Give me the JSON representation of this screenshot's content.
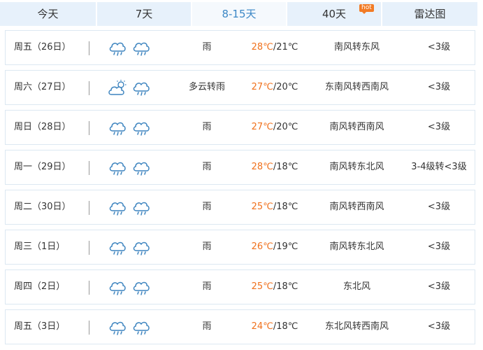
{
  "tabs": [
    {
      "label": "今天",
      "active": false
    },
    {
      "label": "7天",
      "active": false
    },
    {
      "label": "8-15天",
      "active": true
    },
    {
      "label": "40天",
      "active": false,
      "badge": "hot"
    },
    {
      "label": "雷达图",
      "active": false
    }
  ],
  "colors": {
    "accent": "#3c88c6",
    "tab_bg": "#e7f1fb",
    "high_temp": "#f0711c",
    "hot_badge": "#f27b25"
  },
  "forecast": [
    {
      "date": "周五（26日）",
      "icons": [
        "rain-cloud-icon",
        "rain-cloud-icon"
      ],
      "weather": "雨",
      "high": "28℃",
      "low": "/21℃",
      "wind": "南风转东风",
      "level": "<3级"
    },
    {
      "date": "周六（27日）",
      "icons": [
        "partly-cloudy-icon",
        "rain-cloud-icon"
      ],
      "weather": "多云转雨",
      "high": "27℃",
      "low": "/20℃",
      "wind": "东南风转西南风",
      "level": "<3级"
    },
    {
      "date": "周日（28日）",
      "icons": [
        "rain-cloud-icon",
        "rain-cloud-icon"
      ],
      "weather": "雨",
      "high": "27℃",
      "low": "/20℃",
      "wind": "南风转西南风",
      "level": "<3级"
    },
    {
      "date": "周一（29日）",
      "icons": [
        "rain-cloud-icon",
        "rain-cloud-icon"
      ],
      "weather": "雨",
      "high": "28℃",
      "low": "/18℃",
      "wind": "南风转东北风",
      "level": "3-4级转<3级"
    },
    {
      "date": "周二（30日）",
      "icons": [
        "rain-cloud-icon",
        "rain-cloud-icon"
      ],
      "weather": "雨",
      "high": "25℃",
      "low": "/18℃",
      "wind": "南风转西南风",
      "level": "<3级"
    },
    {
      "date": "周三（1日）",
      "icons": [
        "rain-cloud-icon",
        "rain-cloud-icon"
      ],
      "weather": "雨",
      "high": "26℃",
      "low": "/19℃",
      "wind": "南风转东北风",
      "level": "<3级"
    },
    {
      "date": "周四（2日）",
      "icons": [
        "rain-cloud-icon",
        "rain-cloud-icon"
      ],
      "weather": "雨",
      "high": "25℃",
      "low": "/18℃",
      "wind": "东北风",
      "level": "<3级"
    },
    {
      "date": "周五（3日）",
      "icons": [
        "rain-cloud-icon",
        "rain-cloud-icon"
      ],
      "weather": "雨",
      "high": "24℃",
      "low": "/18℃",
      "wind": "东北风转西南风",
      "level": "<3级"
    }
  ]
}
